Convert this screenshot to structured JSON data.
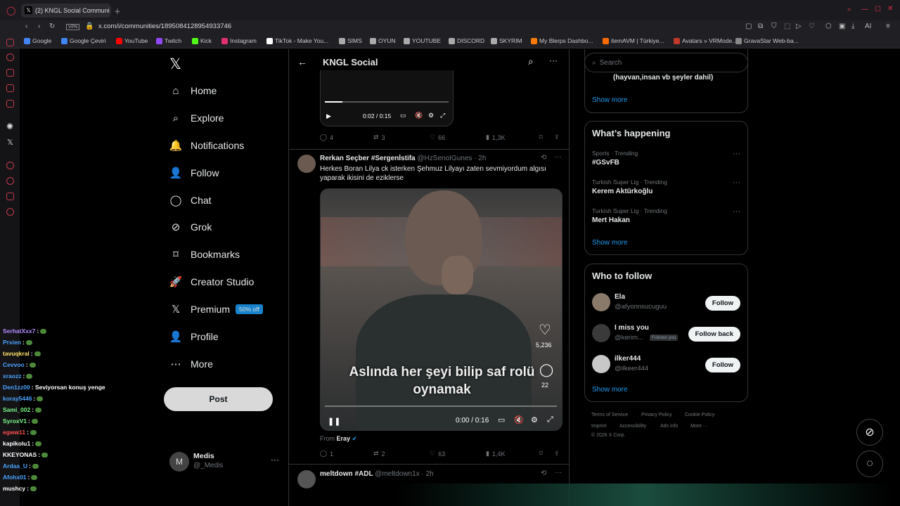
{
  "browser": {
    "tab_title": "(2) KNGL Social Communi",
    "url": "x.com/i/communities/1895084128954933746",
    "vpn": "VPN",
    "ai_label": "AI",
    "bookmarks": [
      "Google",
      "Google Çeviri",
      "YouTube",
      "Twitch",
      "Kick",
      "Instagram",
      "TikTok - Make You...",
      "SIMS",
      "OYUN",
      "YOUTUBE",
      "DISCORD",
      "SKYRIM",
      "My Blerps Dashbo...",
      "itemAVM | Türkiye...",
      "Avatars » VRMode...",
      "GravaStar Web-ba..."
    ]
  },
  "chat": [
    {
      "name": "SerhatXxx7",
      "msg": ":",
      "color": "#b58cff"
    },
    {
      "name": "Prxien",
      "msg": ":",
      "color": "#4aa3ff"
    },
    {
      "name": "tavuqkral",
      "msg": ":",
      "color": "#ffe066"
    },
    {
      "name": "Cevvoo",
      "msg": ":",
      "color": "#4aa3ff"
    },
    {
      "name": "xraozz",
      "msg": ":",
      "color": "#4aa3ff"
    },
    {
      "name": "Den1zz00",
      "msg": ": Seviyorsan konuş yenge",
      "color": "#4aa3ff"
    },
    {
      "name": "koray5446",
      "msg": ":",
      "color": "#4aa3ff"
    },
    {
      "name": "Sami_002",
      "msg": ":",
      "color": "#7CFC8A"
    },
    {
      "name": "SyroxV1",
      "msg": ":",
      "color": "#7CFC8A"
    },
    {
      "name": "egww11",
      "msg": ":",
      "color": "#ff4d4d"
    },
    {
      "name": "kapikolu1",
      "msg": ":",
      "color": "#ffffff"
    },
    {
      "name": "KKEYONAS",
      "msg": ":",
      "color": "#ffffff"
    },
    {
      "name": "Ardaa_U",
      "msg": ":",
      "color": "#4aa3ff"
    },
    {
      "name": "Afohx01",
      "msg": ":",
      "color": "#4aa3ff"
    },
    {
      "name": "mushcy",
      "msg": ":",
      "color": "#ffffff"
    }
  ],
  "nav": {
    "items": [
      "Home",
      "Explore",
      "Notifications",
      "Follow",
      "Chat",
      "Grok",
      "Bookmarks",
      "Creator Studio",
      "Premium",
      "Profile",
      "More"
    ],
    "premium_badge": "50% off",
    "post": "Post",
    "account_name": "Medis",
    "account_handle": "@_Medis",
    "account_initial": "M"
  },
  "header": {
    "title": "KNGL Social"
  },
  "tweet1": {
    "video_time": "0:02 / 0:15",
    "replies": "4",
    "reposts": "3",
    "likes": "66",
    "views": "1,3K"
  },
  "tweet2": {
    "name": "Rerkan Seçber #Sergenİstifa",
    "handle": "@HzSenoIGunes",
    "time": "· 2h",
    "text": "Herkes Boran Lilya ck isterken Şehmuz Lilyayı zaten sevmiyordum algısı yaparak ikisini de eziklerse",
    "caption": "Aslında her şeyi bilip saf rolü oynamak",
    "overlay_likes": "5,236",
    "overlay_comments": "22",
    "video_time": "0:00 / 0:16",
    "from_label": "From",
    "from_name": "Eray",
    "replies": "1",
    "reposts": "2",
    "likes": "63",
    "views": "1,4K"
  },
  "tweet3": {
    "name": "meltdown #ADL",
    "handle": "@meltdown1x",
    "time": "· 2h"
  },
  "right": {
    "search_placeholder": "Search",
    "top_text": "(hayvan,insan vb şeyler dahil)",
    "show_more": "Show more",
    "happening_title": "What’s happening",
    "trends": [
      {
        "sub": "Sports · Trending",
        "main": "#GSvFB"
      },
      {
        "sub": "Turkish Super Lig · Trending",
        "main": "Kerem Aktürkoğlu"
      },
      {
        "sub": "Turkish Super Lig · Trending",
        "main": "Mert Hakan"
      }
    ],
    "wtf_title": "Who to follow",
    "wtf": [
      {
        "name": "Ela",
        "handle": "@afyonnsucuguu",
        "btn": "Follow",
        "follows_you": ""
      },
      {
        "name": "I miss you",
        "handle": "@kerim...",
        "btn": "Follow back",
        "follows_you": "Follows you"
      },
      {
        "name": "ilker444",
        "handle": "@ilkeer444",
        "btn": "Follow",
        "follows_you": ""
      }
    ],
    "footer": [
      "Terms of Service",
      "Privacy Policy",
      "Cookie Policy",
      "Imprint",
      "Accessibility",
      "Ads info",
      "More ···",
      "© 2026 X Corp."
    ]
  },
  "colors": {
    "accent": "#1d9bf0",
    "bg": "#000000",
    "border": "#2f3336"
  }
}
